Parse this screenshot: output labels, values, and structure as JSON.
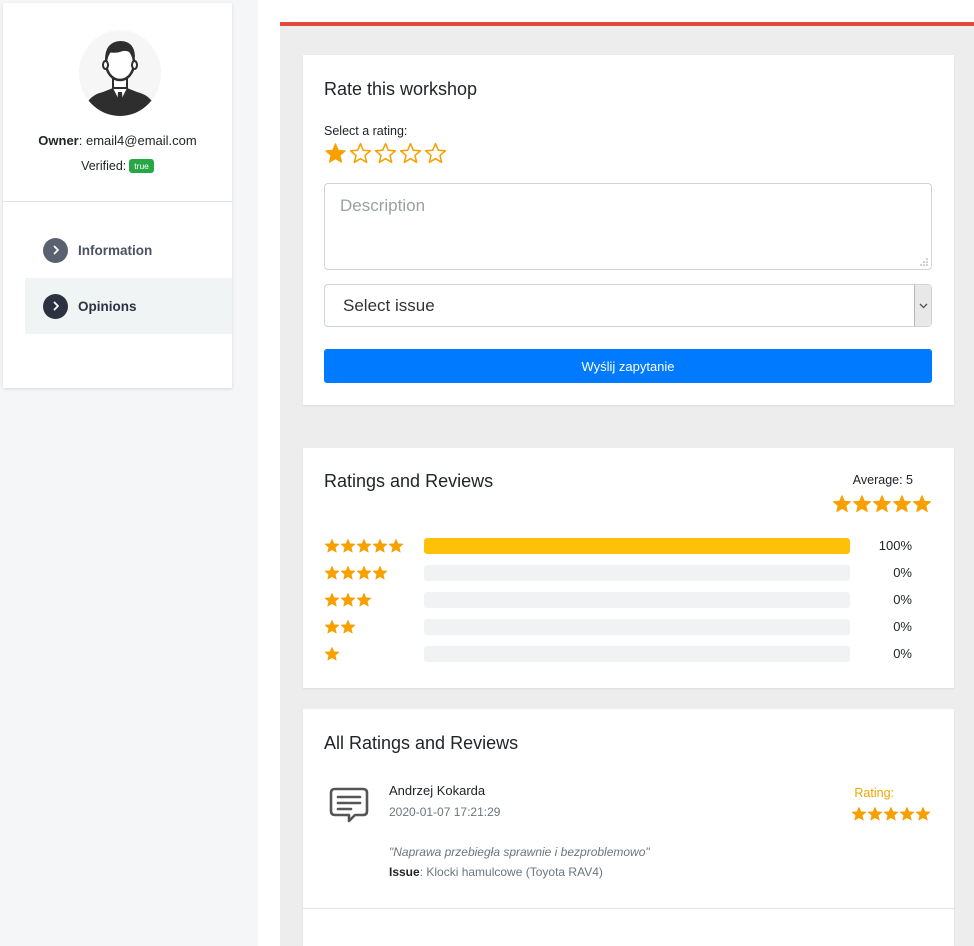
{
  "colors": {
    "accent_red": "#e34a3b",
    "primary_blue": "#007bff",
    "star_orange": "#f7a000",
    "bar_yellow": "#ffc107",
    "nav_info": "#5a6272",
    "nav_active": "#2b3240"
  },
  "sidebar": {
    "owner_label": "Owner",
    "owner_email": ": email4@email.com",
    "verified_label": "Verified:",
    "verified_badge": "true",
    "items": [
      {
        "label": "Information",
        "icon": "chevron-right-icon",
        "active": false
      },
      {
        "label": "Opinions",
        "icon": "chevron-right-icon",
        "active": true
      }
    ]
  },
  "rate_card": {
    "title": "Rate this workshop",
    "select_label": "Select a rating:",
    "selected_rating": 1,
    "max_rating": 5,
    "description_placeholder": "Description",
    "select_value": "Select issue",
    "submit_label": "Wyślij zapytanie"
  },
  "stats_card": {
    "title": "Ratings and Reviews",
    "average_label": "Average: 5",
    "average_stars": 5,
    "distribution": [
      {
        "stars": 5,
        "fraction": 1.0,
        "percent": "100%"
      },
      {
        "stars": 4,
        "fraction": 0,
        "percent": "0%"
      },
      {
        "stars": 3,
        "fraction": 0,
        "percent": "0%"
      },
      {
        "stars": 2,
        "fraction": 0,
        "percent": "0%"
      },
      {
        "stars": 1,
        "fraction": 0,
        "percent": "0%"
      }
    ]
  },
  "reviews_card": {
    "title": "All Ratings and Reviews",
    "reviews": [
      {
        "author": "Andrzej Kokarda",
        "date": "2020-01-07 17:21:29",
        "rating_label": "Rating:",
        "rating": 5,
        "quote": "\"Naprawa przebiegła sprawnie i bezproblemowo\"",
        "issue_label": "Issue",
        "issue_value": ": Klocki hamulcowe (Toyota RAV4)"
      }
    ]
  }
}
